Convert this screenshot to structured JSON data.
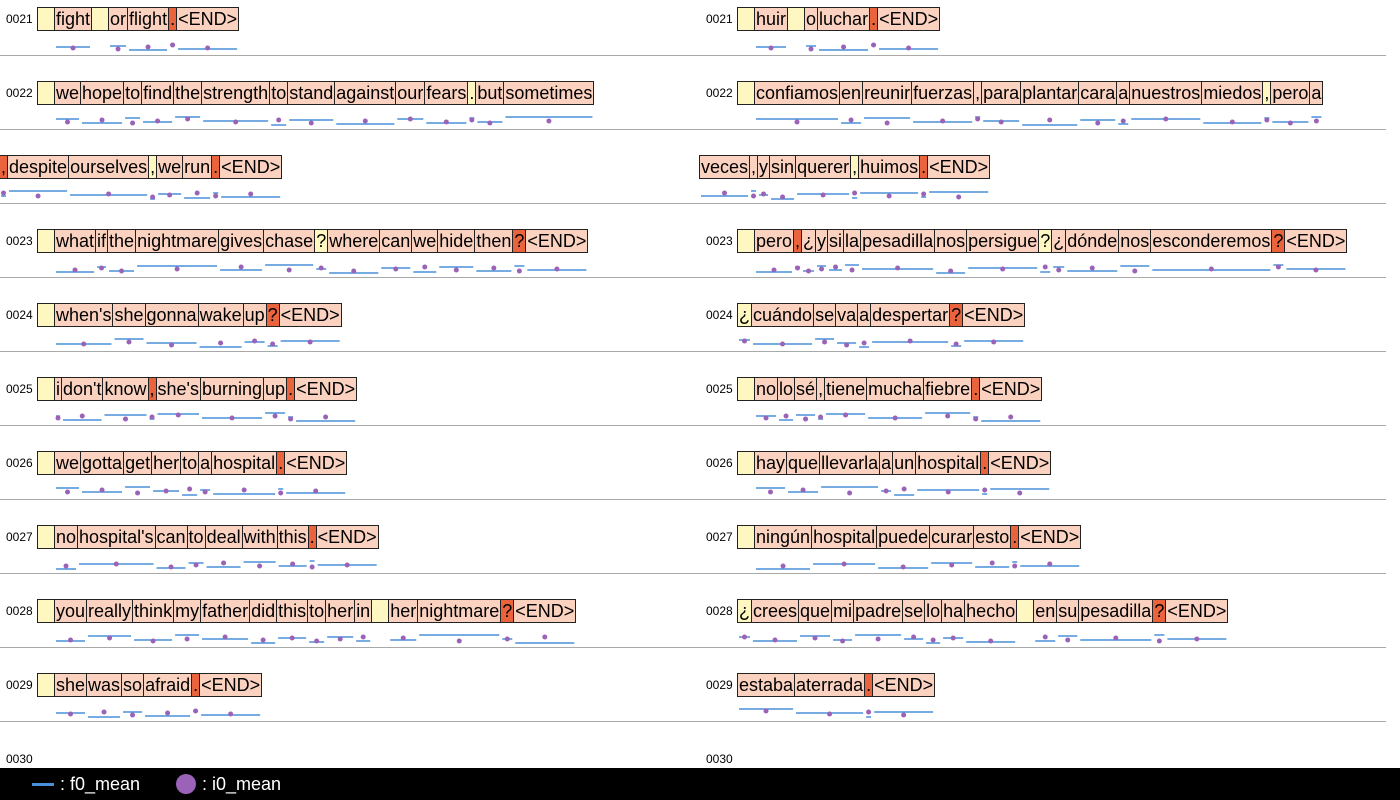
{
  "colors": {
    "pale": "#fff7c2",
    "light": "#fbd2c0",
    "mid": "#f7ae93",
    "strong": "#e9643c",
    "f0_line": "#4a90d9",
    "i0_dot": "#9b63b8"
  },
  "left": [
    {
      "num": "0021",
      "tokens": [
        {
          "t": "",
          "h": "pale"
        },
        {
          "t": "fight",
          "h": "light"
        },
        {
          "t": "",
          "h": "pale"
        },
        {
          "t": "or",
          "h": "light"
        },
        {
          "t": "flight",
          "h": "light"
        },
        {
          "t": ".",
          "h": "strong"
        },
        {
          "t": "<END>",
          "h": "light"
        }
      ]
    },
    {
      "num": "0022",
      "tokens": [
        {
          "t": "",
          "h": "pale"
        },
        {
          "t": "we",
          "h": "light"
        },
        {
          "t": "hope",
          "h": "light"
        },
        {
          "t": "to",
          "h": "light"
        },
        {
          "t": "find",
          "h": "light"
        },
        {
          "t": "the",
          "h": "light"
        },
        {
          "t": "strength",
          "h": "light"
        },
        {
          "t": "to",
          "h": "light"
        },
        {
          "t": "stand",
          "h": "light"
        },
        {
          "t": "against",
          "h": "light"
        },
        {
          "t": "our",
          "h": "light"
        },
        {
          "t": "fears",
          "h": "light"
        },
        {
          "t": ".",
          "h": "pale"
        },
        {
          "t": "but",
          "h": "light"
        },
        {
          "t": "sometimes",
          "h": "light"
        }
      ]
    },
    {
      "num": "",
      "tokens": [
        {
          "t": ",",
          "h": "strong"
        },
        {
          "t": "despite",
          "h": "light"
        },
        {
          "t": "ourselves",
          "h": "light"
        },
        {
          "t": ",",
          "h": "pale"
        },
        {
          "t": "we",
          "h": "light"
        },
        {
          "t": "run",
          "h": "light"
        },
        {
          "t": ".",
          "h": "strong"
        },
        {
          "t": "<END>",
          "h": "light"
        }
      ]
    },
    {
      "num": "0023",
      "tokens": [
        {
          "t": "",
          "h": "pale"
        },
        {
          "t": "what",
          "h": "light"
        },
        {
          "t": "if",
          "h": "light"
        },
        {
          "t": "the",
          "h": "light"
        },
        {
          "t": "nightmare",
          "h": "light"
        },
        {
          "t": "gives",
          "h": "light"
        },
        {
          "t": "chase",
          "h": "light"
        },
        {
          "t": "?",
          "h": "pale"
        },
        {
          "t": "where",
          "h": "light"
        },
        {
          "t": "can",
          "h": "light"
        },
        {
          "t": "we",
          "h": "light"
        },
        {
          "t": "hide",
          "h": "light"
        },
        {
          "t": "then",
          "h": "light"
        },
        {
          "t": "?",
          "h": "strong"
        },
        {
          "t": "<END>",
          "h": "light"
        }
      ]
    },
    {
      "num": "0024",
      "tokens": [
        {
          "t": "",
          "h": "pale"
        },
        {
          "t": "when's",
          "h": "light"
        },
        {
          "t": "she",
          "h": "light"
        },
        {
          "t": "gonna",
          "h": "light"
        },
        {
          "t": "wake",
          "h": "light"
        },
        {
          "t": "up",
          "h": "light"
        },
        {
          "t": "?",
          "h": "strong"
        },
        {
          "t": "<END>",
          "h": "light"
        }
      ]
    },
    {
      "num": "0025",
      "tokens": [
        {
          "t": "",
          "h": "pale"
        },
        {
          "t": "i",
          "h": "light"
        },
        {
          "t": "don't",
          "h": "light"
        },
        {
          "t": "know",
          "h": "light"
        },
        {
          "t": ",",
          "h": "strong"
        },
        {
          "t": "she's",
          "h": "light"
        },
        {
          "t": "burning",
          "h": "light"
        },
        {
          "t": "up",
          "h": "light"
        },
        {
          "t": ".",
          "h": "strong"
        },
        {
          "t": "<END>",
          "h": "light"
        }
      ]
    },
    {
      "num": "0026",
      "tokens": [
        {
          "t": "",
          "h": "pale"
        },
        {
          "t": "we",
          "h": "light"
        },
        {
          "t": "gotta",
          "h": "light"
        },
        {
          "t": "get",
          "h": "light"
        },
        {
          "t": "her",
          "h": "light"
        },
        {
          "t": "to",
          "h": "light"
        },
        {
          "t": "a",
          "h": "light"
        },
        {
          "t": "hospital",
          "h": "light"
        },
        {
          "t": ".",
          "h": "strong"
        },
        {
          "t": "<END>",
          "h": "light"
        }
      ]
    },
    {
      "num": "0027",
      "tokens": [
        {
          "t": "",
          "h": "pale"
        },
        {
          "t": "no",
          "h": "light"
        },
        {
          "t": "hospital's",
          "h": "light"
        },
        {
          "t": "can",
          "h": "light"
        },
        {
          "t": "to",
          "h": "light"
        },
        {
          "t": "deal",
          "h": "light"
        },
        {
          "t": "with",
          "h": "light"
        },
        {
          "t": "this",
          "h": "light"
        },
        {
          "t": ".",
          "h": "strong"
        },
        {
          "t": "<END>",
          "h": "light"
        }
      ]
    },
    {
      "num": "0028",
      "tokens": [
        {
          "t": "",
          "h": "pale"
        },
        {
          "t": "you",
          "h": "light"
        },
        {
          "t": "really",
          "h": "light"
        },
        {
          "t": "think",
          "h": "light"
        },
        {
          "t": "my",
          "h": "light"
        },
        {
          "t": "father",
          "h": "light"
        },
        {
          "t": "did",
          "h": "light"
        },
        {
          "t": "this",
          "h": "light"
        },
        {
          "t": "to",
          "h": "light"
        },
        {
          "t": "her",
          "h": "light"
        },
        {
          "t": "in",
          "h": "light"
        },
        {
          "t": "",
          "h": "pale"
        },
        {
          "t": "her",
          "h": "light"
        },
        {
          "t": "nightmare",
          "h": "light"
        },
        {
          "t": "?",
          "h": "strong"
        },
        {
          "t": "<END>",
          "h": "light"
        }
      ]
    },
    {
      "num": "0029",
      "tokens": [
        {
          "t": "",
          "h": "pale"
        },
        {
          "t": "she",
          "h": "light"
        },
        {
          "t": "was",
          "h": "light"
        },
        {
          "t": "so",
          "h": "light"
        },
        {
          "t": "afraid",
          "h": "light"
        },
        {
          "t": ".",
          "h": "strong"
        },
        {
          "t": "<END>",
          "h": "light"
        }
      ]
    }
  ],
  "right": [
    {
      "num": "0021",
      "tokens": [
        {
          "t": "",
          "h": "pale"
        },
        {
          "t": "huir",
          "h": "light"
        },
        {
          "t": "",
          "h": "pale"
        },
        {
          "t": "o",
          "h": "light"
        },
        {
          "t": "luchar",
          "h": "light"
        },
        {
          "t": ".",
          "h": "strong"
        },
        {
          "t": "<END>",
          "h": "light"
        }
      ]
    },
    {
      "num": "0022",
      "tokens": [
        {
          "t": "",
          "h": "pale"
        },
        {
          "t": "confiamos",
          "h": "light"
        },
        {
          "t": "en",
          "h": "light"
        },
        {
          "t": "reunir",
          "h": "light"
        },
        {
          "t": "fuerzas",
          "h": "light"
        },
        {
          "t": ",",
          "h": "light"
        },
        {
          "t": "para",
          "h": "light"
        },
        {
          "t": "plantar",
          "h": "light"
        },
        {
          "t": "cara",
          "h": "light"
        },
        {
          "t": "a",
          "h": "light"
        },
        {
          "t": "nuestros",
          "h": "light"
        },
        {
          "t": "miedos",
          "h": "light"
        },
        {
          "t": ",",
          "h": "pale"
        },
        {
          "t": "pero",
          "h": "light"
        },
        {
          "t": "a",
          "h": "light"
        }
      ]
    },
    {
      "num": "",
      "tokens": [
        {
          "t": "veces",
          "h": "light"
        },
        {
          "t": ",",
          "h": "light"
        },
        {
          "t": "y",
          "h": "light"
        },
        {
          "t": "sin",
          "h": "light"
        },
        {
          "t": "querer",
          "h": "light"
        },
        {
          "t": ",",
          "h": "pale"
        },
        {
          "t": "huimos",
          "h": "light"
        },
        {
          "t": ".",
          "h": "strong"
        },
        {
          "t": "<END>",
          "h": "light"
        }
      ]
    },
    {
      "num": "0023",
      "tokens": [
        {
          "t": "",
          "h": "pale"
        },
        {
          "t": "pero",
          "h": "light"
        },
        {
          "t": ",",
          "h": "strong"
        },
        {
          "t": "¿",
          "h": "light"
        },
        {
          "t": "y",
          "h": "light"
        },
        {
          "t": "si",
          "h": "light"
        },
        {
          "t": "la",
          "h": "light"
        },
        {
          "t": "pesadilla",
          "h": "light"
        },
        {
          "t": "nos",
          "h": "light"
        },
        {
          "t": "persigue",
          "h": "light"
        },
        {
          "t": "?",
          "h": "pale"
        },
        {
          "t": "¿",
          "h": "light"
        },
        {
          "t": "dónde",
          "h": "light"
        },
        {
          "t": "nos",
          "h": "light"
        },
        {
          "t": "esconderemos",
          "h": "light"
        },
        {
          "t": "?",
          "h": "strong"
        },
        {
          "t": "<END>",
          "h": "light"
        }
      ]
    },
    {
      "num": "0024",
      "tokens": [
        {
          "t": "¿",
          "h": "pale"
        },
        {
          "t": "cuándo",
          "h": "light"
        },
        {
          "t": "se",
          "h": "light"
        },
        {
          "t": "va",
          "h": "light"
        },
        {
          "t": "a",
          "h": "light"
        },
        {
          "t": "despertar",
          "h": "light"
        },
        {
          "t": "?",
          "h": "strong"
        },
        {
          "t": "<END>",
          "h": "light"
        }
      ]
    },
    {
      "num": "0025",
      "tokens": [
        {
          "t": "",
          "h": "pale"
        },
        {
          "t": "no",
          "h": "light"
        },
        {
          "t": "lo",
          "h": "light"
        },
        {
          "t": "sé",
          "h": "light"
        },
        {
          "t": ",",
          "h": "light"
        },
        {
          "t": "tiene",
          "h": "light"
        },
        {
          "t": "mucha",
          "h": "light"
        },
        {
          "t": "fiebre",
          "h": "light"
        },
        {
          "t": ".",
          "h": "strong"
        },
        {
          "t": "<END>",
          "h": "light"
        }
      ]
    },
    {
      "num": "0026",
      "tokens": [
        {
          "t": "",
          "h": "pale"
        },
        {
          "t": "hay",
          "h": "light"
        },
        {
          "t": "que",
          "h": "light"
        },
        {
          "t": "llevarla",
          "h": "light"
        },
        {
          "t": "a",
          "h": "light"
        },
        {
          "t": "un",
          "h": "light"
        },
        {
          "t": "hospital",
          "h": "light"
        },
        {
          "t": ".",
          "h": "strong"
        },
        {
          "t": "<END>",
          "h": "light"
        }
      ]
    },
    {
      "num": "0027",
      "tokens": [
        {
          "t": "",
          "h": "pale"
        },
        {
          "t": "ningún",
          "h": "light"
        },
        {
          "t": "hospital",
          "h": "light"
        },
        {
          "t": "puede",
          "h": "light"
        },
        {
          "t": "curar",
          "h": "light"
        },
        {
          "t": "esto",
          "h": "light"
        },
        {
          "t": ".",
          "h": "strong"
        },
        {
          "t": "<END>",
          "h": "light"
        }
      ]
    },
    {
      "num": "0028",
      "tokens": [
        {
          "t": "¿",
          "h": "pale"
        },
        {
          "t": "crees",
          "h": "light"
        },
        {
          "t": "que",
          "h": "light"
        },
        {
          "t": "mi",
          "h": "light"
        },
        {
          "t": "padre",
          "h": "light"
        },
        {
          "t": "se",
          "h": "light"
        },
        {
          "t": "lo",
          "h": "light"
        },
        {
          "t": "ha",
          "h": "light"
        },
        {
          "t": "hecho",
          "h": "light"
        },
        {
          "t": "",
          "h": "pale"
        },
        {
          "t": "en",
          "h": "light"
        },
        {
          "t": "su",
          "h": "light"
        },
        {
          "t": "pesadilla",
          "h": "light"
        },
        {
          "t": "?",
          "h": "strong"
        },
        {
          "t": "<END>",
          "h": "light"
        }
      ]
    },
    {
      "num": "0029",
      "tokens": [
        {
          "t": "estaba",
          "h": "light"
        },
        {
          "t": "aterrada",
          "h": "light"
        },
        {
          "t": ".",
          "h": "strong"
        },
        {
          "t": "<END>",
          "h": "light"
        }
      ]
    }
  ],
  "trailing_num": "0030",
  "legend": {
    "f0_label": ": f0_mean",
    "i0_label": ": i0_mean"
  }
}
